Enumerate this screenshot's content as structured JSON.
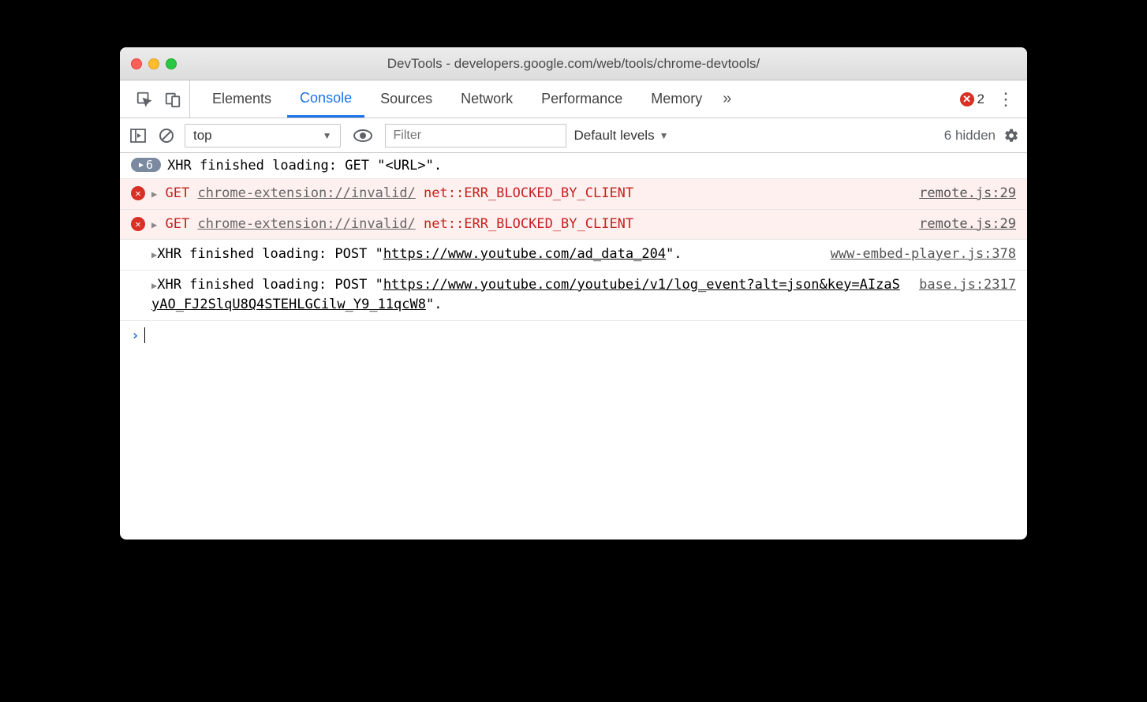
{
  "window": {
    "title": "DevTools - developers.google.com/web/tools/chrome-devtools/"
  },
  "tabs": [
    "Elements",
    "Console",
    "Sources",
    "Network",
    "Performance",
    "Memory"
  ],
  "active_tab": "Console",
  "error_count": "2",
  "subbar": {
    "context": "top",
    "filter_placeholder": "Filter",
    "levels": "Default levels",
    "hidden": "6 hidden"
  },
  "logs": {
    "badge_count": "6",
    "row0": "XHR finished loading: GET \"<URL>\".",
    "err_method": "GET",
    "err_url": "chrome-extension://invalid/",
    "err_msg": "net::ERR_BLOCKED_BY_CLIENT",
    "err_src": "remote.js:29",
    "xhr1_pre": "XHR finished loading: POST \"",
    "xhr1_url": "https://www.youtube.com/ad_data_204",
    "xhr1_post": "\".",
    "xhr1_src": "www-embed-player.js:378",
    "xhr2_pre": "XHR finished loading: POST \"",
    "xhr2_url": "https://www.youtube.com/youtubei/v1/log_event?alt=json&key=AIzaSyAO_FJ2SlqU8Q4STEHLGCilw_Y9_11qcW8",
    "xhr2_post": "\".",
    "xhr2_src": "base.js:2317"
  }
}
